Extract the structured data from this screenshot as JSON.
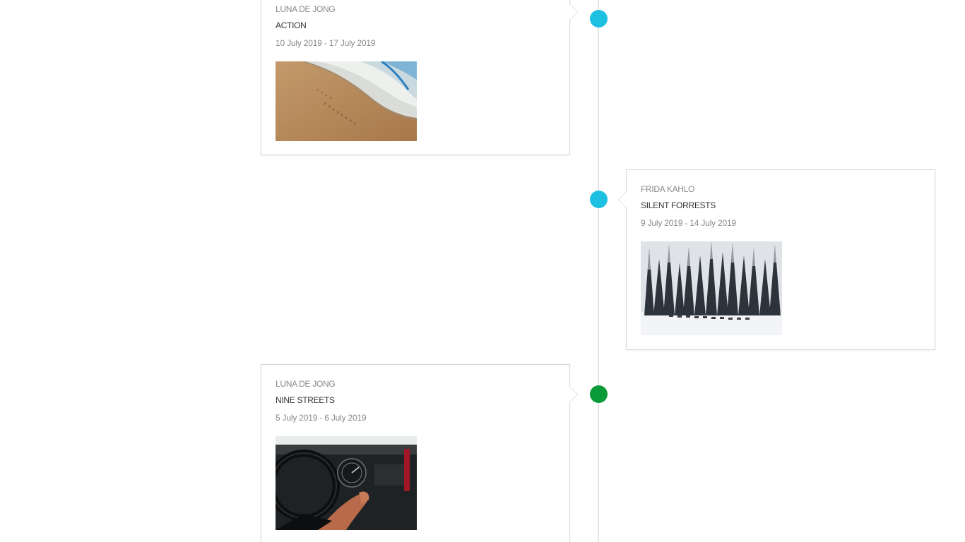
{
  "timeline": {
    "items": [
      {
        "artist": "LUNA DE JONG",
        "title": "ACTION",
        "dates": "10 July 2019 - 17 July 2019",
        "image_alt": "beach-waves-photo",
        "dot_color": "#1ec0e2"
      },
      {
        "artist": "FRIDA KAHLO",
        "title": "SILENT FORRESTS",
        "dates": "9 July 2019 - 14 July 2019",
        "image_alt": "snowy-forest-photo",
        "dot_color": "#1ec0e2"
      },
      {
        "artist": "LUNA DE JONG",
        "title": "NINE STREETS",
        "dates": "5 July 2019 - 6 July 2019",
        "image_alt": "car-dashboard-photo",
        "dot_color": "#0a9b38"
      }
    ]
  },
  "colors": {
    "dot_active": "#1ec0e2",
    "dot_current": "#0a9b38",
    "line": "#e4e4e4",
    "card_border": "#d9d9d9"
  }
}
